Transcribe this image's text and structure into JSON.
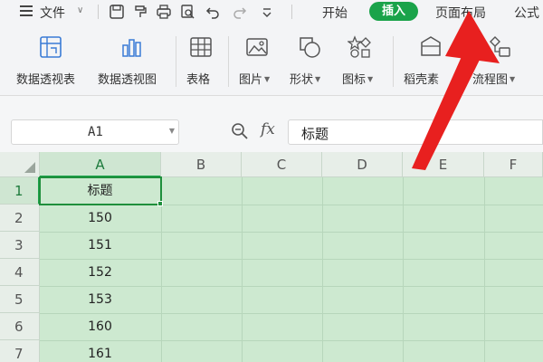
{
  "menubar": {
    "file_label": "文件",
    "file_dropdown_icon": "chevron-down-icon",
    "quick_access_icons": [
      "save-icon",
      "format-painter-icon",
      "print-icon",
      "print-preview-icon",
      "undo-icon",
      "redo-icon",
      "more-dropdown-icon"
    ],
    "tabs": {
      "start": "开始",
      "insert": "插入",
      "page_layout": "页面布局",
      "formula": "公式"
    },
    "active_tab_color": "#1aa34a"
  },
  "ribbon": {
    "buttons": [
      {
        "label": "数据透视表",
        "icon": "pivot-table-icon"
      },
      {
        "label": "数据透视图",
        "icon": "pivot-chart-icon"
      },
      {
        "label": "表格",
        "icon": "table-icon"
      },
      {
        "label": "图片",
        "icon": "picture-icon",
        "dropdown": true
      },
      {
        "label": "形状",
        "icon": "shapes-icon",
        "dropdown": true
      },
      {
        "label": "图标",
        "icon": "icons-icon",
        "dropdown": true
      },
      {
        "label": "稻壳素",
        "icon": "docer-material-icon"
      },
      {
        "label": "流程图",
        "icon": "flowchart-icon",
        "dropdown": true
      }
    ]
  },
  "formula_bar": {
    "name_box": "A1",
    "fx_label": "fx",
    "formula_value": "标题",
    "zoom_icon": "zoom-icon"
  },
  "grid": {
    "columns": [
      "A",
      "B",
      "C",
      "D",
      "E",
      "F"
    ],
    "rows": [
      "1",
      "2",
      "3",
      "4",
      "5",
      "6",
      "7"
    ],
    "selected_cell": "A1",
    "column_a_values": [
      "标题",
      "150",
      "151",
      "152",
      "153",
      "160",
      "161"
    ],
    "selection_color": "#1f8f3c",
    "fill_color": "#cde9d0"
  },
  "annotation": {
    "arrow_color": "#e8201f",
    "arrow_icon": "red-arrow-icon"
  }
}
